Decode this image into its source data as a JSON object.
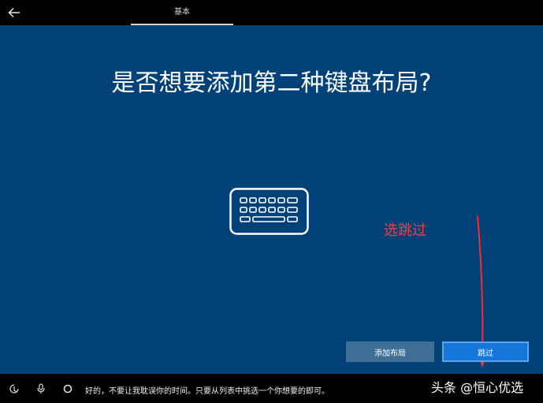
{
  "header": {
    "tab_label": "基本"
  },
  "main": {
    "title": "是否想要添加第二种键盘布局?",
    "icon": "keyboard-icon",
    "annotation": "选跳过",
    "annotation_color": "#ff3b3b",
    "buttons": {
      "add_layout": "添加布局",
      "skip": "跳过"
    },
    "background_color": "#024279"
  },
  "bottom_bar": {
    "icons": [
      "ease-of-access-icon",
      "microphone-icon",
      "cortana-circle-icon"
    ],
    "cortana_text": "好的，不要让我耽误你的时间。只要从列表中挑选一个你想要的即可。",
    "watermark": "头条 @恒心优选"
  }
}
